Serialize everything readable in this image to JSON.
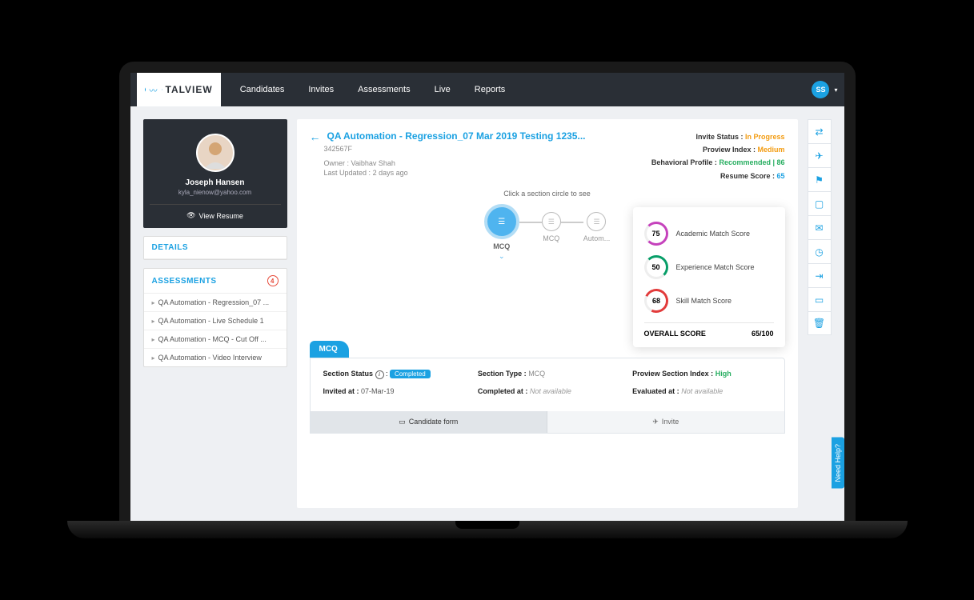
{
  "brand": "TALVIEW",
  "nav": {
    "items": [
      "Candidates",
      "Invites",
      "Assessments",
      "Live",
      "Reports"
    ]
  },
  "user": {
    "initials": "SS"
  },
  "profile": {
    "name": "Joseph Hansen",
    "email": "kyla_nienow@yahoo.com",
    "view_resume": "View Resume"
  },
  "details_label": "DETAILS",
  "assessments_label": "ASSESSMENTS",
  "assessments_count": "4",
  "assessments": [
    "QA Automation - Regression_07 ...",
    "QA Automation - Live Schedule 1",
    "QA Automation - MCQ - Cut Off ...",
    "QA Automation - Video Interview"
  ],
  "main": {
    "title": "QA Automation - Regression_07 Mar 2019 Testing 1235...",
    "id": "342567F",
    "owner_label": "Owner :",
    "owner": "Vaibhav Shah",
    "updated_label": "Last Updated :",
    "updated": "2 days ago",
    "stats": {
      "invite_status_label": "Invite Status :",
      "invite_status": "In Progress",
      "proview_index_label": "Proview Index :",
      "proview_index": "Medium",
      "behavioral_label": "Behavioral Profile :",
      "behavioral": "Recommended | 86",
      "resume_score_label": "Resume Score :",
      "resume_score": "65"
    },
    "section_hint": "Click a section circle to see",
    "circles": {
      "main_label": "MCQ",
      "rest": [
        "MCQ",
        "Autom..."
      ]
    }
  },
  "popover": {
    "academic": {
      "score": "75",
      "label": "Academic Match Score"
    },
    "experience": {
      "score": "50",
      "label": "Experience Match Score"
    },
    "skill": {
      "score": "68",
      "label": "Skill Match Score"
    },
    "overall_label": "OVERALL SCORE",
    "overall_value": "65/100"
  },
  "section_tab": "MCQ",
  "section": {
    "status_label": "Section Status",
    "status_value": "Completed",
    "type_label": "Section Type :",
    "type_value": "MCQ",
    "proview_label": "Proview Section Index :",
    "proview_value": "High",
    "invited_label": "Invited at :",
    "invited_value": "07-Mar-19",
    "completed_label": "Completed at :",
    "completed_value": "Not available",
    "evaluated_label": "Evaluated at :",
    "evaluated_value": "Not available",
    "candidate_form": "Candidate form",
    "invite": "Invite"
  },
  "help": "Need Help?"
}
